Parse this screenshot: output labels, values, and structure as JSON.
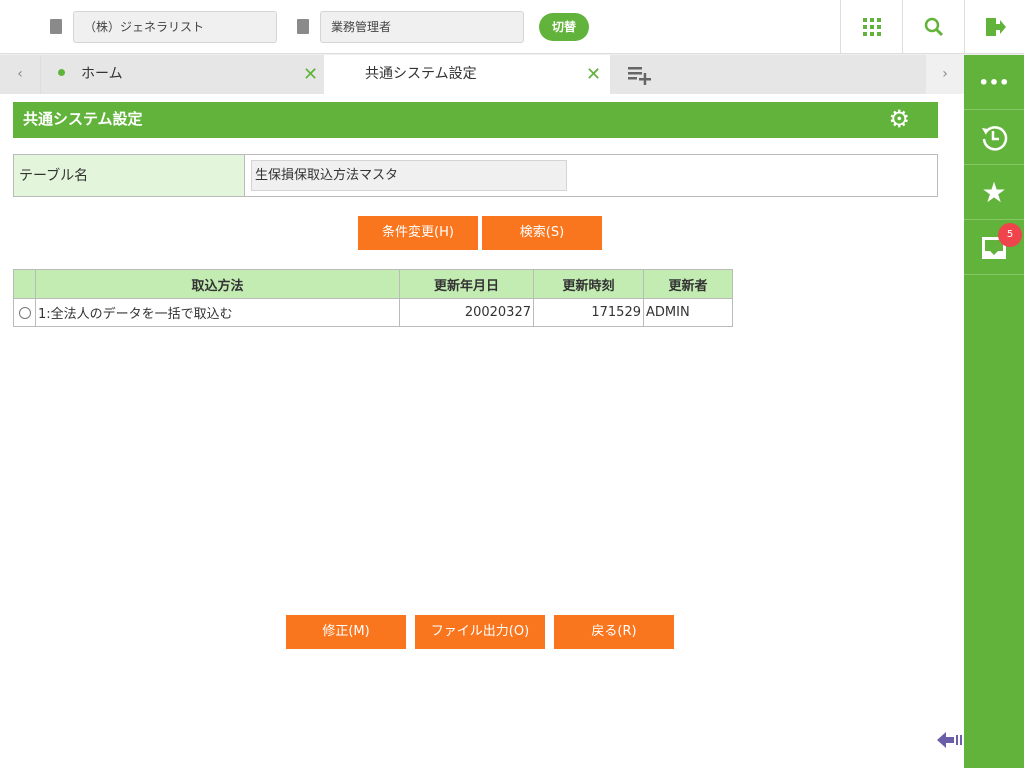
{
  "topbar": {
    "company": "（株）ジェネラリスト",
    "role": "業務管理者",
    "switch_label": "切替"
  },
  "tabs": [
    {
      "label": "ホーム"
    },
    {
      "label": "共通システム設定"
    }
  ],
  "page": {
    "title": "共通システム設定",
    "table_name_label": "テーブル名",
    "table_name_value": "生保損保取込方法マスタ"
  },
  "buttons": {
    "change_conditions": "条件変更(H)",
    "search": "検索(S)",
    "modify": "修正(M)",
    "file_output": "ファイル出力(O)",
    "back": "戻る(R)"
  },
  "grid": {
    "headers": [
      "取込方法",
      "更新年月日",
      "更新時刻",
      "更新者"
    ],
    "rows": [
      {
        "method": "1:全法人のデータを一括で取込む",
        "date": "20020327",
        "time": "171529",
        "user": "ADMIN"
      }
    ]
  },
  "rail": {
    "badge_count": "5"
  },
  "colors": {
    "green": "#62b33b",
    "orange": "#fa761e",
    "badge": "#f0444c"
  }
}
